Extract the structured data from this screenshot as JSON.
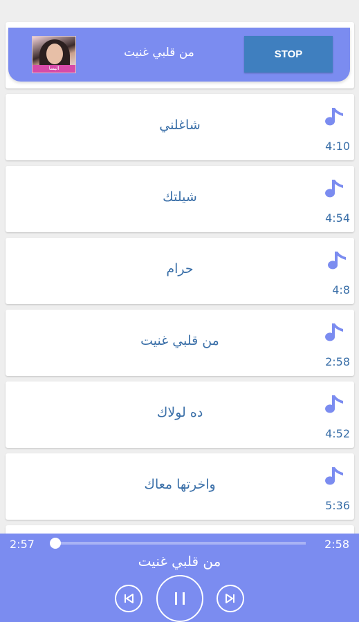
{
  "banner": {
    "now_playing_title": "من قلبي غنيت",
    "cover_caption": "اليسا",
    "stop_label": "STOP"
  },
  "songs": [
    {
      "title": "شاغلني",
      "duration": "4:10"
    },
    {
      "title": "شيلتك",
      "duration": "4:54"
    },
    {
      "title": "حرام",
      "duration": "4:8"
    },
    {
      "title": "من قلبي غنيت",
      "duration": "2:58"
    },
    {
      "title": "ده لولاك",
      "duration": "4:52"
    },
    {
      "title": "واخرتها معاك",
      "duration": "5:36"
    }
  ],
  "player": {
    "current_time": "2:57",
    "total_time": "2:58",
    "progress": 0.01,
    "song_title": "من قلبي غنيت",
    "controls": [
      "previous-icon",
      "pause-icon",
      "next-icon"
    ]
  },
  "colors": {
    "accent": "#7b8cf0",
    "stop_button": "#3f7fbf",
    "text_blue": "#3a6fa8",
    "note_icon": "#7b8cf0"
  }
}
